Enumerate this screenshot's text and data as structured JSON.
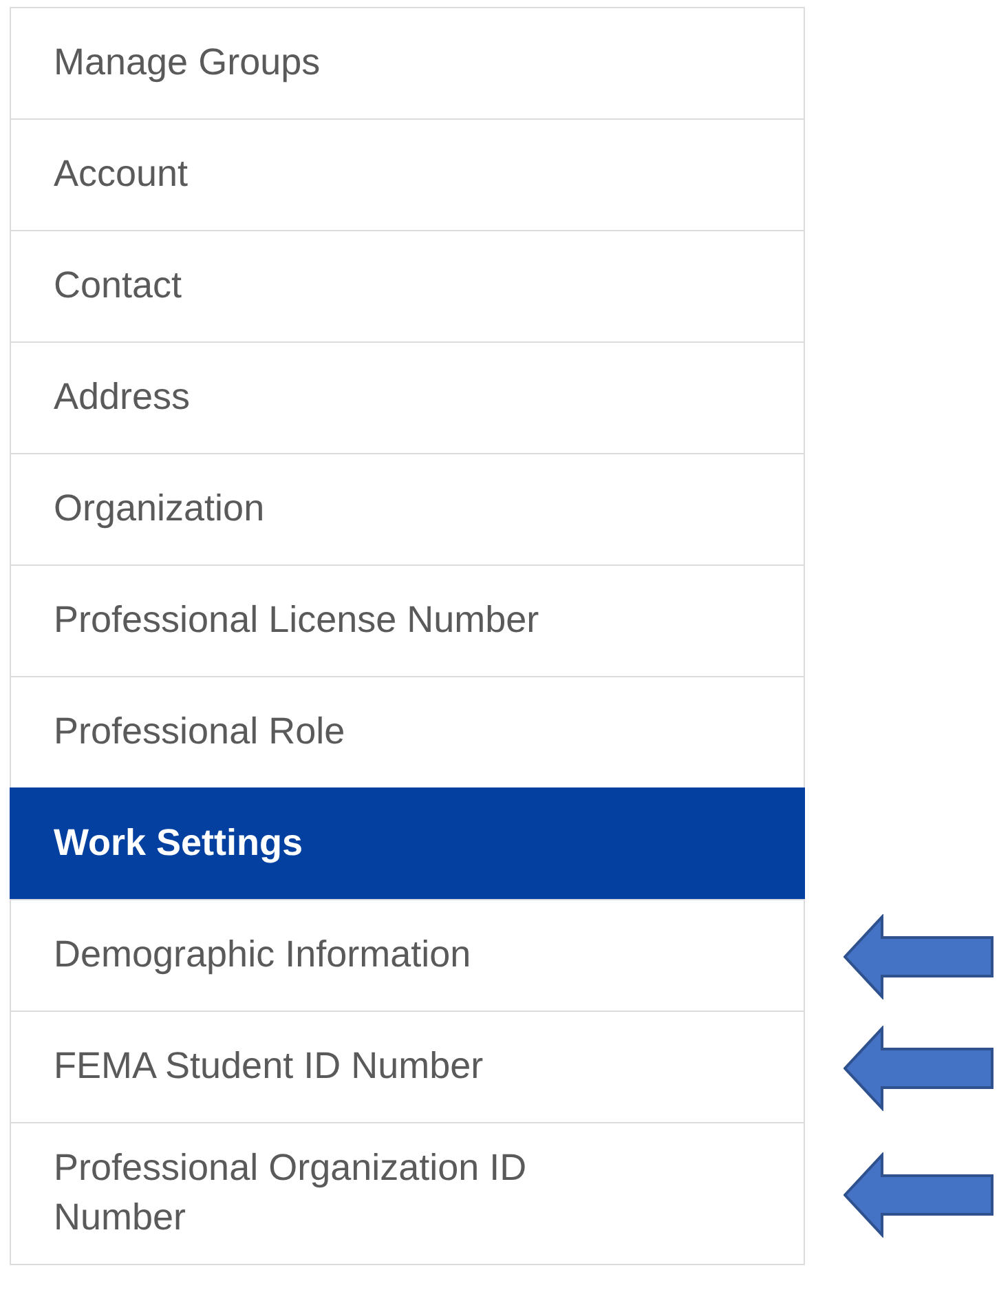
{
  "menu": {
    "items": [
      {
        "label": "Manage Groups",
        "selected": false,
        "flagged": false
      },
      {
        "label": "Account",
        "selected": false,
        "flagged": false
      },
      {
        "label": "Contact",
        "selected": false,
        "flagged": false
      },
      {
        "label": "Address",
        "selected": false,
        "flagged": false
      },
      {
        "label": "Organization",
        "selected": false,
        "flagged": false
      },
      {
        "label": "Professional License Number",
        "selected": false,
        "flagged": false
      },
      {
        "label": "Professional Role",
        "selected": false,
        "flagged": false
      },
      {
        "label": "Work Settings",
        "selected": true,
        "flagged": false
      },
      {
        "label": "Demographic Information",
        "selected": false,
        "flagged": true
      },
      {
        "label": "FEMA Student ID Number",
        "selected": false,
        "flagged": true
      },
      {
        "label": "Professional Organization ID Number",
        "selected": false,
        "flagged": true
      }
    ]
  }
}
